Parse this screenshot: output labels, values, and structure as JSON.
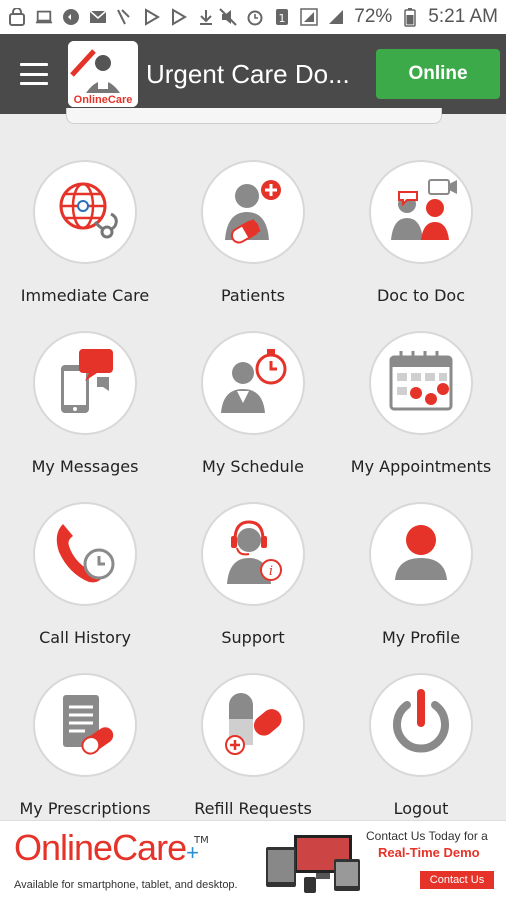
{
  "status_bar": {
    "battery": "72%",
    "time": "5:21 AM",
    "left_icons": [
      "lock-app-icon",
      "laptop-icon",
      "chat-icon",
      "mail-icon",
      "missed-call-icon",
      "play-store-icon",
      "play-store-icon",
      "download-icon"
    ],
    "right_icons": [
      "mute-icon",
      "alarm-icon",
      "sim-icon",
      "signal-box-icon",
      "signal-icon"
    ]
  },
  "app_bar": {
    "title": "Urgent Care Do...",
    "status_button": "Online",
    "logo_text": "OnlineCare"
  },
  "tiles": [
    {
      "label": "Immediate Care",
      "icon": "globe-stethoscope-icon"
    },
    {
      "label": "Patients",
      "icon": "patient-pill-icon"
    },
    {
      "label": "Doc to Doc",
      "icon": "doctors-video-icon"
    },
    {
      "label": "My Messages",
      "icon": "phone-message-icon"
    },
    {
      "label": "My Schedule",
      "icon": "doctor-timer-icon"
    },
    {
      "label": "My Appointments",
      "icon": "calendar-check-icon"
    },
    {
      "label": "Call History",
      "icon": "phone-history-icon"
    },
    {
      "label": "Support",
      "icon": "support-agent-icon"
    },
    {
      "label": "My Profile",
      "icon": "user-profile-icon"
    },
    {
      "label": "My Prescriptions",
      "icon": "prescription-icon"
    },
    {
      "label": "Refill Requests",
      "icon": "refill-pills-icon"
    },
    {
      "label": "Logout",
      "icon": "power-icon"
    }
  ],
  "banner": {
    "brand_online": "Online",
    "brand_care": "Care",
    "brand_plus": "+",
    "trademark": "TM",
    "tagline": "Available for smartphone, tablet, and desktop.",
    "contact_text": "Contact Us Today for a",
    "demo_text": "Real-Time Demo",
    "contact_button": "Contact Us"
  },
  "colors": {
    "accent_red": "#e63329",
    "app_bar": "#4a4a4a",
    "online_green": "#3daa4a",
    "icon_gray": "#8a8a8a"
  }
}
